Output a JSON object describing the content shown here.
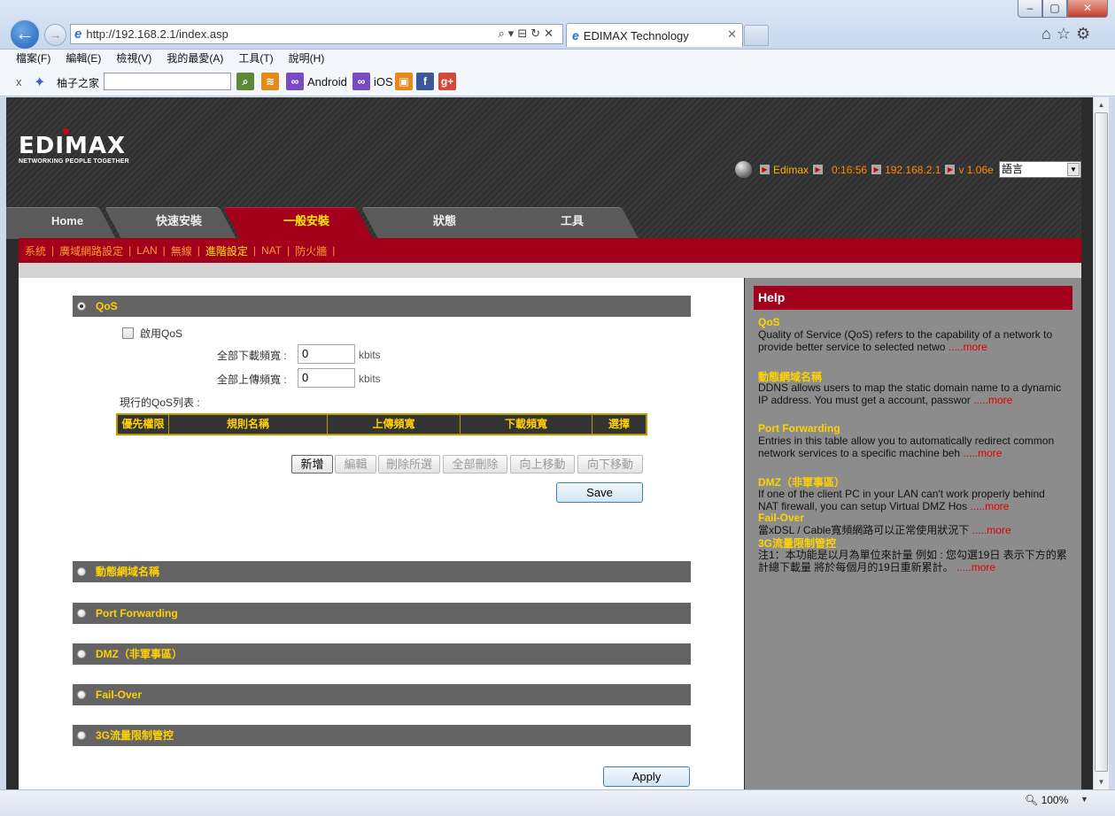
{
  "browser": {
    "url": "http://192.168.2.1/index.asp",
    "tab_title": "EDIMAX Technology",
    "menu": [
      "檔案(F)",
      "編輯(E)",
      "檢視(V)",
      "我的最愛(A)",
      "工具(T)",
      "說明(H)"
    ],
    "favorites": {
      "site": "柚子之家",
      "android": "Android",
      "ios": "iOS"
    },
    "zoom": "100%"
  },
  "router": {
    "logo_word": "EDIMAX",
    "logo_tagline": "NETWORKING PEOPLE TOGETHER",
    "status": {
      "name": "Edimax",
      "uptime": "0:16:56",
      "ip": "192.168.2.1",
      "version": "v 1.06e"
    },
    "language": "語言",
    "nav_tabs": [
      "Home",
      "快速安裝",
      "一般安裝",
      "狀態",
      "工具"
    ],
    "active_tab": "一般安裝",
    "subnav": [
      "系統",
      "廣域網路設定",
      "LAN",
      "無線",
      "進階設定",
      "NAT",
      "防火牆"
    ],
    "active_subnav": "進階設定",
    "sections": [
      "QoS",
      "動態網域名稱",
      "Port Forwarding",
      "DMZ（非軍事區）",
      "Fail-Over",
      "3G流量限制管控"
    ],
    "qos": {
      "enable_label": "啟用QoS",
      "enabled": false,
      "download_label": "全部下載頻寬 :",
      "download_value": "0",
      "upload_label": "全部上傳頻寬 :",
      "upload_value": "0",
      "unit": "kbits",
      "list_label": "現行的QoS列表 :",
      "table_headers": [
        "優先權限",
        "規則名稱",
        "上傳頻寬",
        "下載頻寬",
        "選擇"
      ],
      "buttons": {
        "add": "新增",
        "edit": "編輯",
        "delete_selected": "刪除所選",
        "delete_all": "全部刪除",
        "move_up": "向上移動",
        "move_down": "向下移動"
      },
      "save": "Save"
    },
    "apply": "Apply",
    "help": {
      "title": "Help",
      "items": [
        {
          "head": "QoS",
          "body": "Quality of Service (QoS) refers to the capability of a network to provide better service to selected netwo",
          "more": ".....more"
        },
        {
          "head": "動態網域名稱",
          "body": "DDNS allows users to map the static domain name to a dynamic IP address. You must get a account, passwor",
          "more": ".....more"
        },
        {
          "head": "Port Forwarding",
          "body": "Entries in this table allow you to automatically redirect common network services to a specific machine beh",
          "more": ".....more"
        },
        {
          "head": "DMZ（非軍事區）",
          "body": "If one of the client PC in your LAN can't work properly behind NAT firewall, you can setup Virtual DMZ Hos",
          "more": ".....more"
        },
        {
          "head": "Fail-Over",
          "body": "當xDSL / Cable寬頻網路可以正常使用狀況下",
          "more": ".....more"
        },
        {
          "head": "3G流量限制管控",
          "body": "注1：本功能是以月為單位來計量   例如 : 您勾選19日 表示下方的累計總下載量  將於每個月的19日重新累計。",
          "more": ".....more"
        }
      ]
    }
  }
}
